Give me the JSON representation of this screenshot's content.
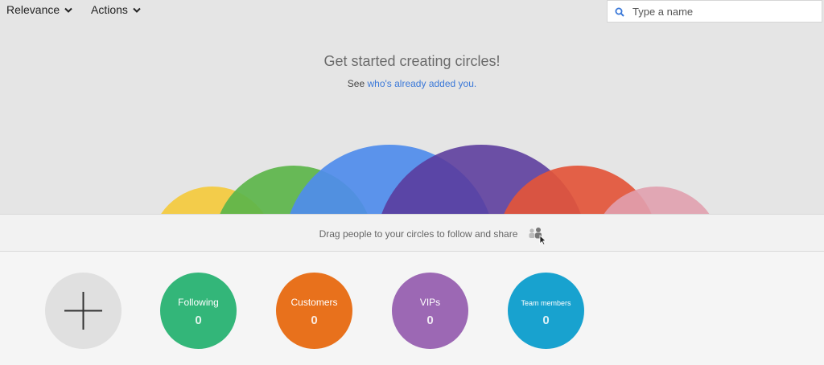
{
  "toolbar": {
    "relevance_label": "Relevance",
    "actions_label": "Actions",
    "search_placeholder": "Type a name"
  },
  "header": {
    "title": "Get started creating circles!",
    "subtitle_prefix": "See",
    "subtitle_link": "who's already added you."
  },
  "drag_band": {
    "text": "Drag people to your circles to follow and share"
  },
  "circles": [
    {
      "name": "Following",
      "count": "0",
      "color": "#33b679"
    },
    {
      "name": "Customers",
      "count": "0",
      "color": "#e8711c"
    },
    {
      "name": "VIPs",
      "count": "0",
      "color": "#9c68b4"
    },
    {
      "name": "Team members",
      "count": "0",
      "color": "#18a2cf"
    }
  ],
  "arc_colors": {
    "yellow": "#f3cc4a",
    "green": "#5cb54a",
    "blue": "#4f8ceb",
    "purple": "#5a3a9c",
    "red": "#e3553a",
    "pink": "#e0a0ae"
  },
  "icons": [
    "search-icon",
    "chevron-down-icon",
    "plus-icon",
    "drag-people-icon"
  ]
}
